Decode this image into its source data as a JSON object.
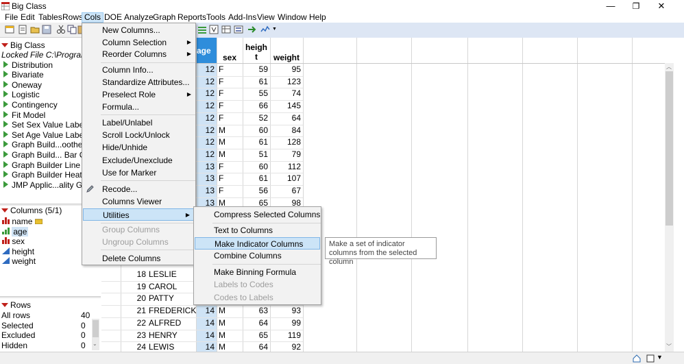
{
  "window": {
    "title": "Big Class",
    "minimize": "—",
    "restore": "❐",
    "close": "✕"
  },
  "menubar": [
    "File",
    "Edit",
    "Tables",
    "Rows",
    "Cols",
    "DOE",
    "Analyze",
    "Graph",
    "Reports",
    "Tools",
    "Add-Ins",
    "View",
    "Window",
    "Help"
  ],
  "left": {
    "table_title": "Big Class",
    "locked_label": "Locked File  C:\\Program",
    "scripts": [
      "Distribution",
      "Bivariate",
      "Oneway",
      "Logistic",
      "Contingency",
      "Fit Model",
      "Set Sex Value Labels",
      "Set Age Value Labels",
      "Graph Build...oother",
      "Graph Build... Bar Ch",
      "Graph Builder Line C",
      "Graph Builder Heat M",
      "JMP Applic...ality Gra"
    ],
    "columns_header": "Columns (5/1)",
    "columns": [
      "name",
      "age",
      "sex",
      "height",
      "weight"
    ],
    "rows_header": "Rows",
    "rows_stats": [
      {
        "label": "All rows",
        "value": "40"
      },
      {
        "label": "Selected",
        "value": "0"
      },
      {
        "label": "Excluded",
        "value": "0"
      },
      {
        "label": "Hidden",
        "value": "0"
      }
    ]
  },
  "grid": {
    "headers": {
      "age": "age",
      "sex": "sex",
      "height_l1": "heigh",
      "height_l2": "t",
      "weight": "weight"
    },
    "top_rows": [
      [
        "12",
        "F",
        "59",
        "95"
      ],
      [
        "12",
        "F",
        "61",
        "123"
      ],
      [
        "12",
        "F",
        "55",
        "74"
      ],
      [
        "12",
        "F",
        "66",
        "145"
      ],
      [
        "12",
        "F",
        "52",
        "64"
      ],
      [
        "12",
        "M",
        "60",
        "84"
      ],
      [
        "12",
        "M",
        "61",
        "128"
      ],
      [
        "12",
        "M",
        "51",
        "79"
      ],
      [
        "13",
        "F",
        "60",
        "112"
      ],
      [
        "13",
        "F",
        "61",
        "107"
      ],
      [
        "13",
        "F",
        "56",
        "67"
      ],
      [
        "13",
        "M",
        "65",
        "98"
      ]
    ],
    "bottom_rows": [
      {
        "num": "18",
        "name": "LESLIE",
        "age": "",
        "sex": "",
        "height": "",
        "weight": ""
      },
      {
        "num": "19",
        "name": "CAROL",
        "age": "",
        "sex": "",
        "height": "",
        "weight": ""
      },
      {
        "num": "20",
        "name": "PATTY",
        "age": "",
        "sex": "",
        "height": "",
        "weight": ""
      },
      {
        "num": "21",
        "name": "FREDERICK",
        "age": "14",
        "sex": "M",
        "height": "63",
        "weight": "93"
      },
      {
        "num": "22",
        "name": "ALFRED",
        "age": "14",
        "sex": "M",
        "height": "64",
        "weight": "99"
      },
      {
        "num": "23",
        "name": "HENRY",
        "age": "14",
        "sex": "M",
        "height": "65",
        "weight": "119"
      },
      {
        "num": "24",
        "name": "LEWIS",
        "age": "14",
        "sex": "M",
        "height": "64",
        "weight": "92"
      }
    ]
  },
  "cols_menu": {
    "new_columns": "New Columns...",
    "column_selection": "Column Selection",
    "reorder_columns": "Reorder Columns",
    "column_info": "Column Info...",
    "standardize": "Standardize Attributes...",
    "preselect_role": "Preselect Role",
    "formula": "Formula...",
    "label_unlabel": "Label/Unlabel",
    "scroll_lock": "Scroll Lock/Unlock",
    "hide_unhide": "Hide/Unhide",
    "exclude_unexclude": "Exclude/Unexclude",
    "use_for_marker": "Use for Marker",
    "recode": "Recode...",
    "columns_viewer": "Columns Viewer",
    "utilities": "Utilities",
    "group_columns": "Group Columns",
    "ungroup_columns": "Ungroup Columns",
    "delete_columns": "Delete Columns"
  },
  "utilities_menu": {
    "compress": "Compress Selected Columns",
    "text_to_columns": "Text to Columns",
    "make_indicator": "Make Indicator Columns",
    "combine": "Combine Columns",
    "binning": "Make Binning Formula",
    "labels_to_codes": "Labels to Codes",
    "codes_to_labels": "Codes to Labels"
  },
  "tooltip": "Make a set of indicator columns from the selected column",
  "colors": {
    "accent": "#cce4f7",
    "selected_col": "#cfe3f5",
    "header_selected": "#2e8ddb",
    "red": "#c0201a",
    "green": "#3a9a3a"
  }
}
